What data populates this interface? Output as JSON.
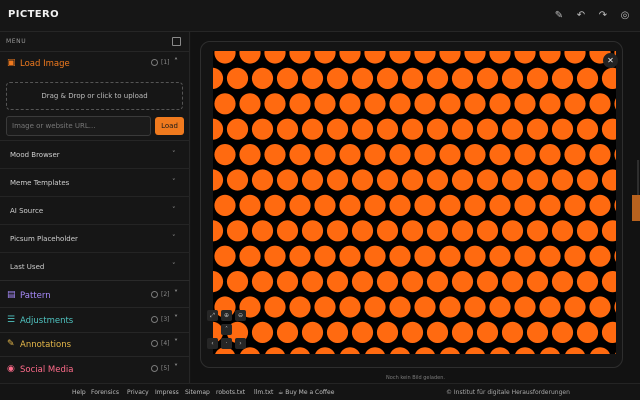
{
  "app": {
    "logo": "PICTERO"
  },
  "header": {
    "icons": [
      "pen-icon",
      "undo-icon",
      "redo-icon",
      "palette-icon"
    ]
  },
  "sidebar": {
    "menu_label": "MENU",
    "load_image": {
      "title": "Load Image",
      "count": "[1]",
      "color": "#f07a1e",
      "dropzone_text": "Drag & Drop or click to upload",
      "url_placeholder": "Image or website URL...",
      "load_label": "Load",
      "items": [
        "Mood Browser",
        "Meme Templates",
        "AI Source",
        "Picsum Placeholder",
        "Last Used"
      ]
    },
    "sections": [
      {
        "title": "Pattern",
        "count": "[2]",
        "color": "#a78bfa",
        "icon": "pattern-icon"
      },
      {
        "title": "Adjustments",
        "count": "[3]",
        "color": "#4fc3c0",
        "icon": "sliders-icon"
      },
      {
        "title": "Annotations",
        "count": "[4]",
        "color": "#e6b84a",
        "icon": "pencil-icon"
      },
      {
        "title": "Social Media",
        "count": "[5]",
        "color": "#ff6b8a",
        "icon": "share-icon"
      }
    ]
  },
  "canvas": {
    "caption": "Noch kein Bild geladen.",
    "pattern_colors": {
      "dot": "#ff6a10",
      "background": "#000000"
    }
  },
  "footer": {
    "links": [
      "Help",
      "Forensics",
      "Privacy",
      "Impress",
      "Sitemap",
      "robots.txt",
      "llm.txt",
      "☕ Buy Me a Coffee"
    ],
    "copyright": "© Institut für digitale Herausforderungen"
  }
}
